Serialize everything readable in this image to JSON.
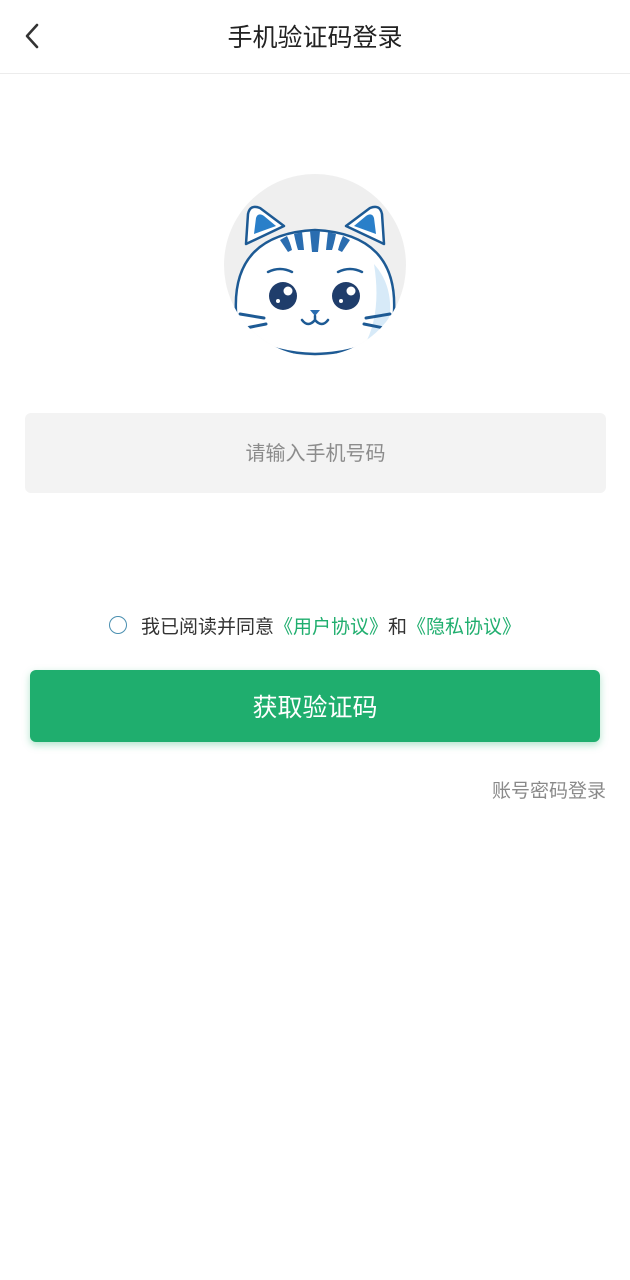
{
  "header": {
    "title": "手机验证码登录",
    "back_icon": "chevron-left-icon"
  },
  "avatar": {
    "icon": "cat-mascot-logo"
  },
  "phone": {
    "placeholder": "请输入手机号码",
    "value": ""
  },
  "agreement": {
    "checked": false,
    "prefix": "我已阅读并同意",
    "user_agreement": "《用户协议》",
    "conjunction": "和",
    "privacy_policy": "《隐私协议》"
  },
  "actions": {
    "get_code_label": "获取验证码",
    "account_login_label": "账号密码登录"
  },
  "colors": {
    "accent": "#1fae6e",
    "mascot_blue": "#2a6db0"
  }
}
